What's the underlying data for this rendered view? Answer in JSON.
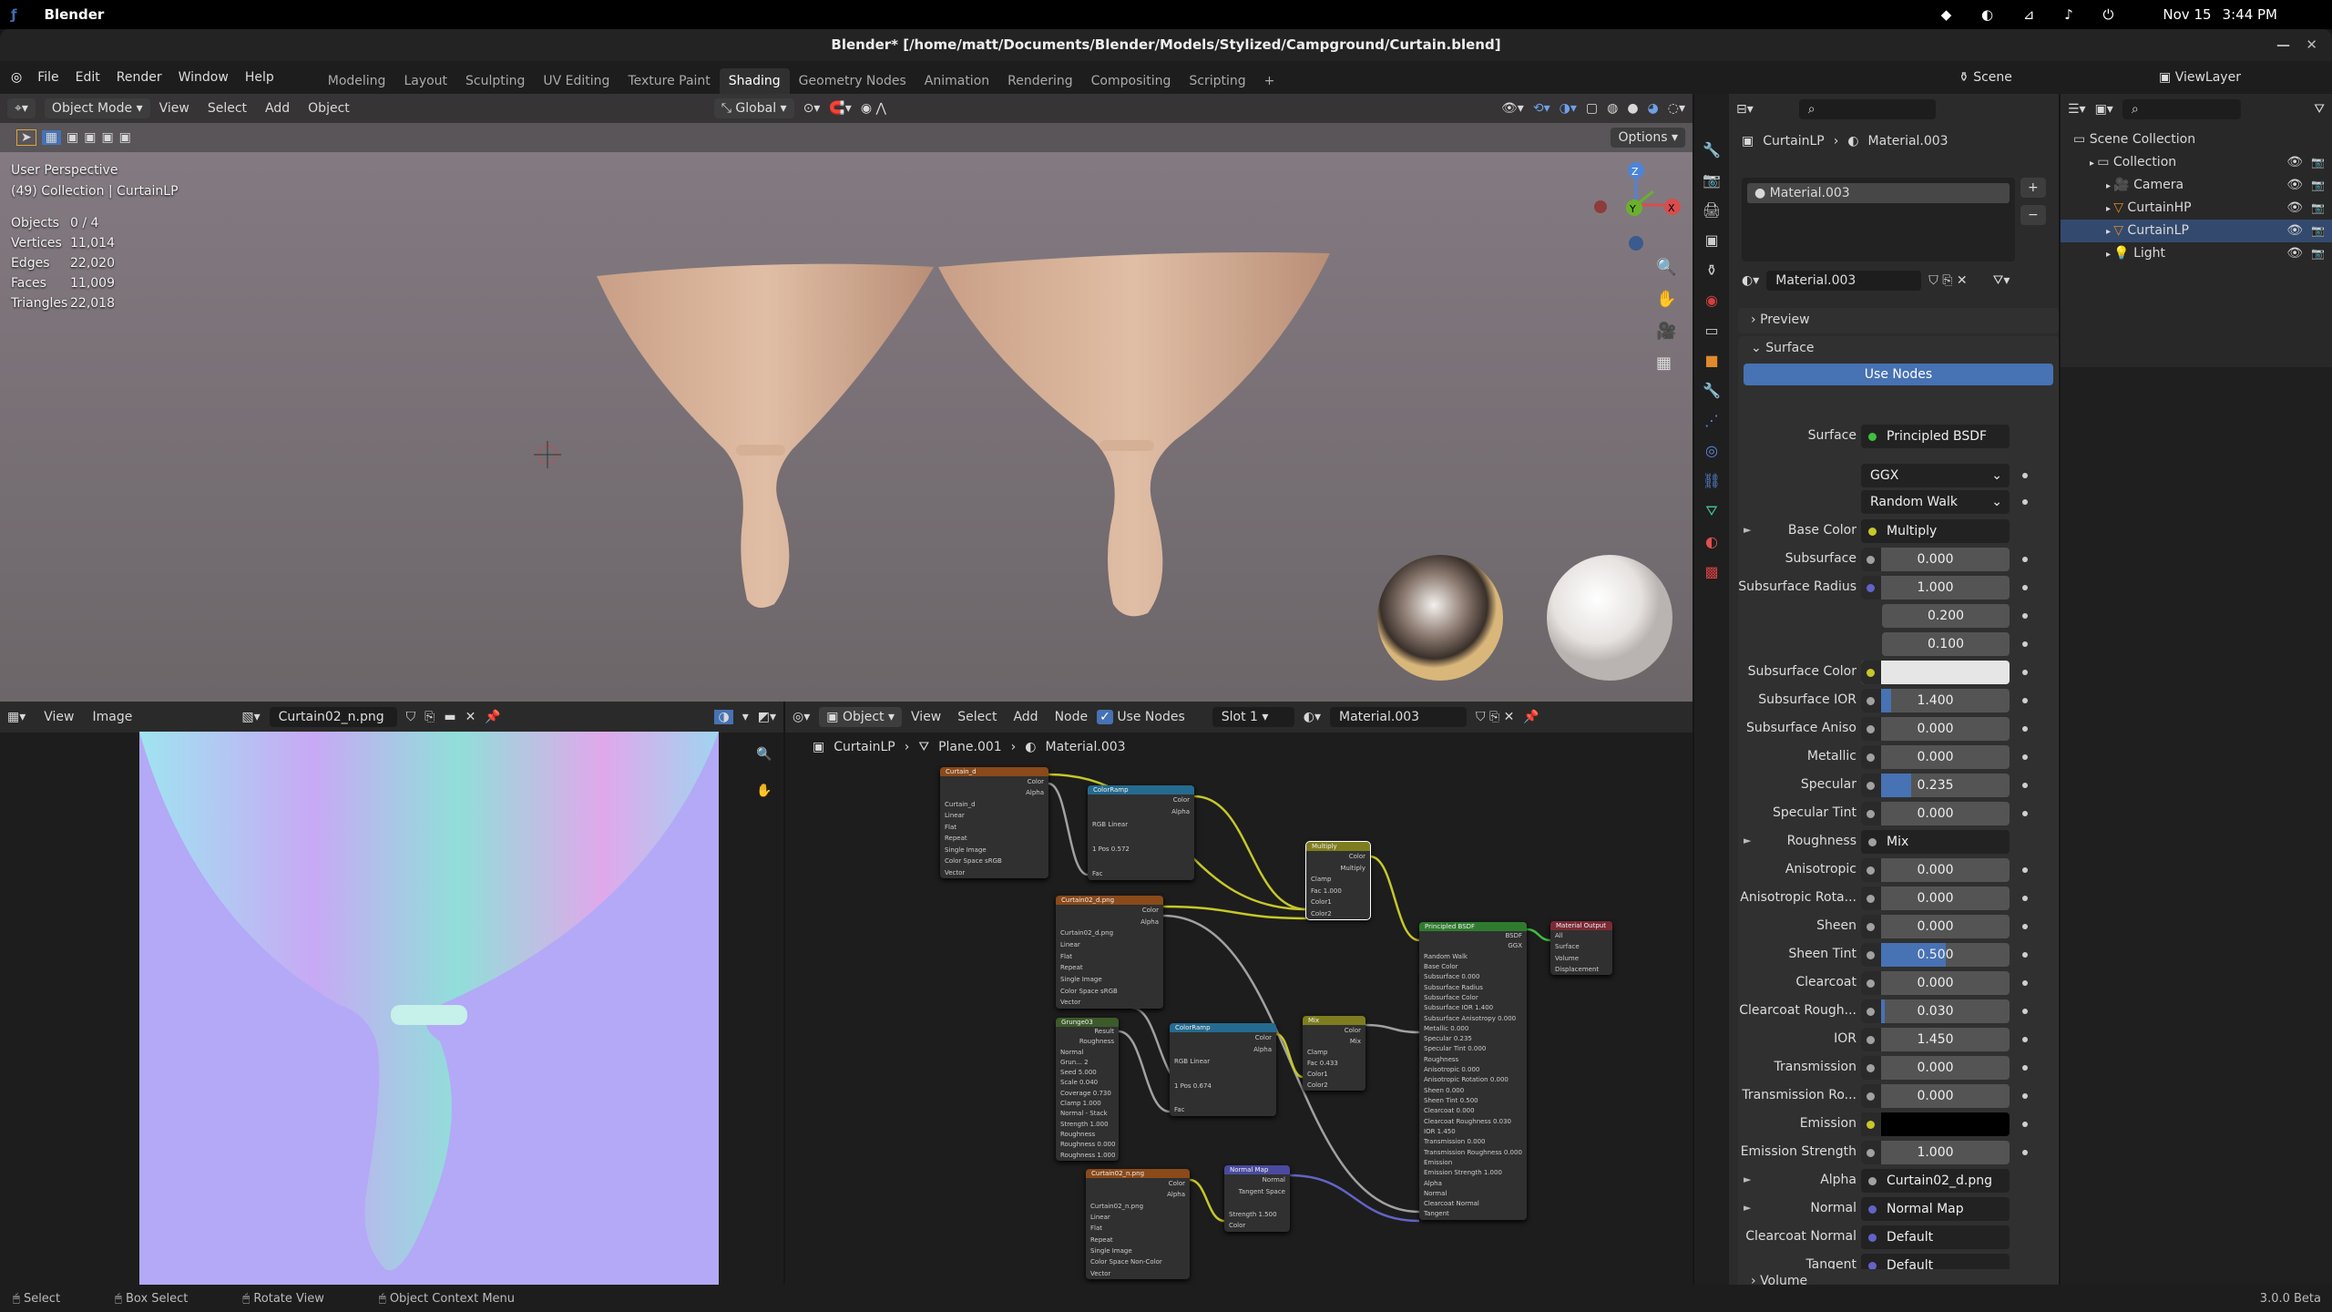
{
  "os": {
    "app": "Blender",
    "date": "Nov 15",
    "time": "3:44 PM"
  },
  "window": {
    "title": "Blender* [/home/matt/Documents/Blender/Models/Stylized/Campground/Curtain.blend]"
  },
  "menu": {
    "items": [
      "File",
      "Edit",
      "Render",
      "Window",
      "Help"
    ],
    "workspaces": [
      "Modeling",
      "Layout",
      "Sculpting",
      "UV Editing",
      "Texture Paint",
      "Shading",
      "Geometry Nodes",
      "Animation",
      "Rendering",
      "Compositing",
      "Scripting"
    ],
    "active": "Shading",
    "add": "+",
    "scene": "Scene",
    "view_layer": "ViewLayer"
  },
  "viewport": {
    "mode": "Object Mode",
    "menus": [
      "View",
      "Select",
      "Add",
      "Object"
    ],
    "orientation": "Global",
    "options": "Options",
    "overlay_title": "User Perspective",
    "overlay_sub": "(49) Collection | CurtainLP",
    "stats": [
      {
        "k": "Objects",
        "v": "0 / 4"
      },
      {
        "k": "Vertices",
        "v": "11,014"
      },
      {
        "k": "Edges",
        "v": "22,020"
      },
      {
        "k": "Faces",
        "v": "11,009"
      },
      {
        "k": "Triangles",
        "v": "22,018"
      }
    ],
    "gizmo": {
      "z": "Z",
      "x": "X",
      "y": "Y"
    }
  },
  "image_editor": {
    "menus": [
      "View",
      "Image"
    ],
    "image": "Curtain02_n.png"
  },
  "node_editor": {
    "object": "Object",
    "menus": [
      "View",
      "Select",
      "Add",
      "Node"
    ],
    "use_nodes": "Use Nodes",
    "slot": "Slot 1",
    "material": "Material.003",
    "breadcrumb": [
      "CurtainLP",
      "Plane.001",
      "Material.003"
    ],
    "nodes": [
      {
        "title": "Curtain_d",
        "color": "#8a4a1a",
        "rows": [
          "Color",
          "Alpha",
          "Curtain_d",
          "Linear",
          "Flat",
          "Repeat",
          "Single Image",
          "Color Space  sRGB",
          "Vector"
        ]
      },
      {
        "title": "ColorRamp",
        "color": "#256b8f",
        "rows": [
          "Color",
          "Alpha",
          "RGB  Linear",
          "",
          "1   Pos  0.572",
          "",
          "Fac"
        ]
      },
      {
        "title": "Multiply",
        "color": "#7d7d1f",
        "rows": [
          "Color",
          "Multiply",
          "Clamp",
          "Fac  1.000",
          "Color1",
          "Color2"
        ]
      },
      {
        "title": "Curtain02_d.png",
        "color": "#8a4a1a",
        "rows": [
          "Color",
          "Alpha",
          "Curtain02_d.png",
          "Linear",
          "Flat",
          "Repeat",
          "Single Image",
          "Color Space  sRGB",
          "Vector"
        ]
      },
      {
        "title": "Principled BSDF",
        "color": "#2f7a2f",
        "rows": [
          "BSDF",
          "GGX",
          "Random Walk",
          "Base Color",
          "Subsurface  0.000",
          "Subsurface Radius",
          "Subsurface Color",
          "Subsurface IOR  1.400",
          "Subsurface Anisotropy  0.000",
          "Metallic  0.000",
          "Specular  0.235",
          "Specular Tint  0.000",
          "Roughness",
          "Anisotropic  0.000",
          "Anisotropic Rotation  0.000",
          "Sheen  0.000",
          "Sheen Tint  0.500",
          "Clearcoat  0.000",
          "Clearcoat Roughness  0.030",
          "IOR  1.450",
          "Transmission  0.000",
          "Transmission Roughness  0.000",
          "Emission",
          "Emission Strength  1.000",
          "Alpha",
          "Normal",
          "Clearcoat Normal",
          "Tangent"
        ]
      },
      {
        "title": "Material Output",
        "color": "#7a2a35",
        "rows": [
          "All",
          "Surface",
          "Volume",
          "Displacement"
        ]
      },
      {
        "title": "Grunge03",
        "color": "#3d5a2a",
        "rows": [
          "Result",
          "Roughness",
          "Normal",
          "Grun... 2",
          "Seed  5.000",
          "Scale  0.040",
          "Coverage  0.730",
          "Clamp  1.000",
          "Normal - Stack",
          "Strength  1.000",
          "Roughness",
          "Roughness 0.000",
          "Roughness 1.000"
        ]
      },
      {
        "title": "ColorRamp",
        "color": "#256b8f",
        "rows": [
          "Color",
          "Alpha",
          "RGB  Linear",
          "",
          "1   Pos  0.674",
          "",
          "Fac"
        ]
      },
      {
        "title": "Mix",
        "color": "#7d7d1f",
        "rows": [
          "Color",
          "Mix",
          "Clamp",
          "Fac  0.433",
          "Color1",
          "Color2"
        ]
      },
      {
        "title": "Curtain02_n.png",
        "color": "#8a4a1a",
        "rows": [
          "Color",
          "Alpha",
          "Curtain02_n.png",
          "Linear",
          "Flat",
          "Repeat",
          "Single Image",
          "Color Space  Non-Color",
          "Vector"
        ]
      },
      {
        "title": "Normal Map",
        "color": "#4a4aa0",
        "rows": [
          "Normal",
          "Tangent Space",
          "",
          "Strength  1.500",
          "Color"
        ]
      }
    ]
  },
  "properties": {
    "breadcrumb": [
      "CurtainLP",
      "Material.003"
    ],
    "slot": "Material.003",
    "material": "Material.003",
    "preview": "Preview",
    "surface_panel": "Surface",
    "use_nodes": "Use Nodes",
    "volume": "Volume",
    "rows": [
      {
        "label": "Surface",
        "type": "link",
        "value": "Principled BSDF",
        "sock": "#3fbf3f"
      },
      {
        "label": "",
        "type": "drop",
        "value": "GGX"
      },
      {
        "label": "",
        "type": "drop",
        "value": "Random Walk"
      },
      {
        "label": "Base Color",
        "type": "link",
        "value": "Multiply",
        "sock": "#c7c729",
        "expand": true
      },
      {
        "label": "Subsurface",
        "type": "num",
        "value": "0.000",
        "fill": 0
      },
      {
        "label": "Subsurface Radius",
        "type": "num",
        "value": "1.000",
        "fill": 0,
        "sock": "#6363c7"
      },
      {
        "label": "",
        "type": "num",
        "value": "0.200",
        "fill": 0,
        "nosock": true
      },
      {
        "label": "",
        "type": "num",
        "value": "0.100",
        "fill": 0,
        "nosock": true
      },
      {
        "label": "Subsurface Color",
        "type": "color",
        "value": "",
        "color": "#e6e6e6",
        "sock": "#c7c729"
      },
      {
        "label": "Subsurface IOR",
        "type": "num",
        "value": "1.400",
        "fill": 0.08
      },
      {
        "label": "Subsurface Aniso",
        "type": "num",
        "value": "0.000",
        "fill": 0
      },
      {
        "label": "Metallic",
        "type": "num",
        "value": "0.000",
        "fill": 0
      },
      {
        "label": "Specular",
        "type": "num",
        "value": "0.235",
        "fill": 0.235
      },
      {
        "label": "Specular Tint",
        "type": "num",
        "value": "0.000",
        "fill": 0
      },
      {
        "label": "Roughness",
        "type": "link",
        "value": "Mix",
        "expand": true
      },
      {
        "label": "Anisotropic",
        "type": "num",
        "value": "0.000",
        "fill": 0
      },
      {
        "label": "Anisotropic Rota...",
        "type": "num",
        "value": "0.000",
        "fill": 0
      },
      {
        "label": "Sheen",
        "type": "num",
        "value": "0.000",
        "fill": 0
      },
      {
        "label": "Sheen Tint",
        "type": "num",
        "value": "0.500",
        "fill": 0.5
      },
      {
        "label": "Clearcoat",
        "type": "num",
        "value": "0.000",
        "fill": 0
      },
      {
        "label": "Clearcoat Rough...",
        "type": "num",
        "value": "0.030",
        "fill": 0.03
      },
      {
        "label": "IOR",
        "type": "num",
        "value": "1.450",
        "fill": 0
      },
      {
        "label": "Transmission",
        "type": "num",
        "value": "0.000",
        "fill": 0
      },
      {
        "label": "Transmission Ro...",
        "type": "num",
        "value": "0.000",
        "fill": 0
      },
      {
        "label": "Emission",
        "type": "color",
        "value": "",
        "color": "#000000",
        "sock": "#c7c729"
      },
      {
        "label": "Emission Strength",
        "type": "num",
        "value": "1.000",
        "fill": 0
      },
      {
        "label": "Alpha",
        "type": "link",
        "value": "Curtain02_d.png",
        "expand": true
      },
      {
        "label": "Normal",
        "type": "link",
        "value": "Normal Map",
        "sock": "#6363c7",
        "expand": true
      },
      {
        "label": "Clearcoat Normal",
        "type": "link",
        "value": "Default",
        "sock": "#6363c7",
        "nokey": true
      },
      {
        "label": "Tangent",
        "type": "link",
        "value": "Default",
        "sock": "#6363c7",
        "nokey": true
      }
    ]
  },
  "outliner": {
    "items": [
      {
        "name": "Scene Collection",
        "depth": 0,
        "icon": "collection-icon"
      },
      {
        "name": "Collection",
        "depth": 1,
        "icon": "collection-icon"
      },
      {
        "name": "Camera",
        "depth": 2,
        "icon": "camera-icon"
      },
      {
        "name": "CurtainHP",
        "depth": 2,
        "icon": "mesh-icon"
      },
      {
        "name": "CurtainLP",
        "depth": 2,
        "icon": "mesh-icon"
      },
      {
        "name": "Light",
        "depth": 2,
        "icon": "light-icon"
      }
    ]
  },
  "statusbar": {
    "items": [
      "Select",
      "Box Select",
      "Rotate View",
      "Object Context Menu"
    ],
    "version": "3.0.0 Beta"
  },
  "colors": {
    "accent": "#4772b3",
    "header": "#2a2a2a"
  }
}
